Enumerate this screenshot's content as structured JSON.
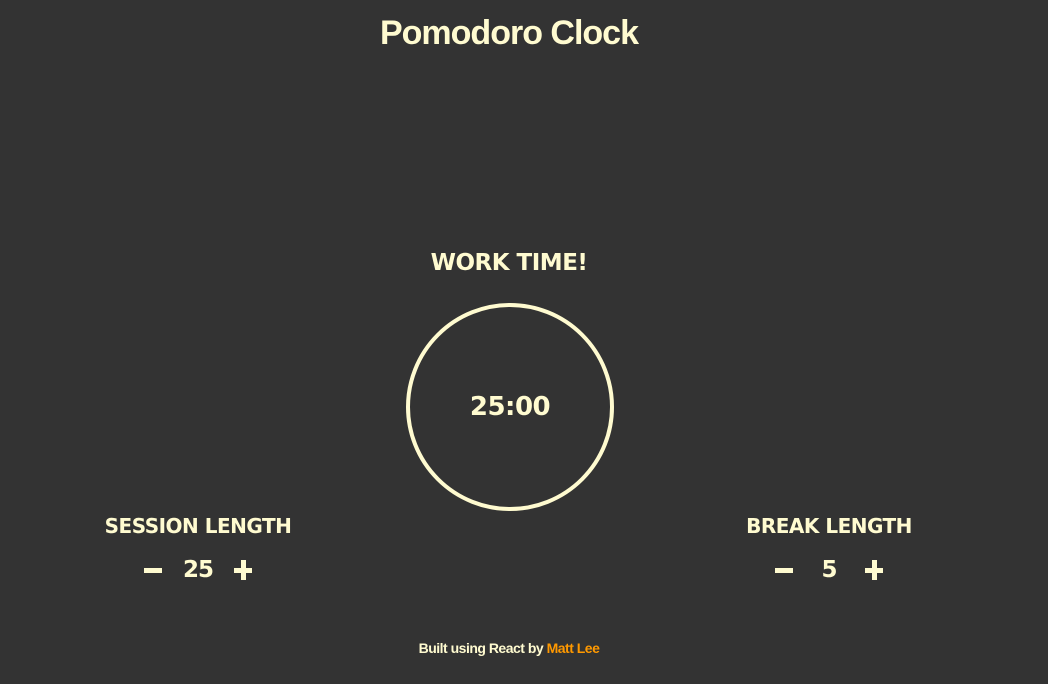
{
  "app": {
    "title": "Pomodoro Clock"
  },
  "timer": {
    "status": "WORK TIME!",
    "time": "25:00"
  },
  "session": {
    "label": "SESSION LENGTH",
    "value": "25",
    "decrement_icon": "minus-icon",
    "increment_icon": "plus-icon"
  },
  "break": {
    "label": "BREAK LENGTH",
    "value": "5",
    "decrement_icon": "minus-icon",
    "increment_icon": "plus-icon"
  },
  "footer": {
    "prefix": "Built using React by ",
    "author_link": "Matt Lee"
  },
  "colors": {
    "background": "#333333",
    "text": "#fffbd0",
    "accent_link": "#ff9900"
  }
}
